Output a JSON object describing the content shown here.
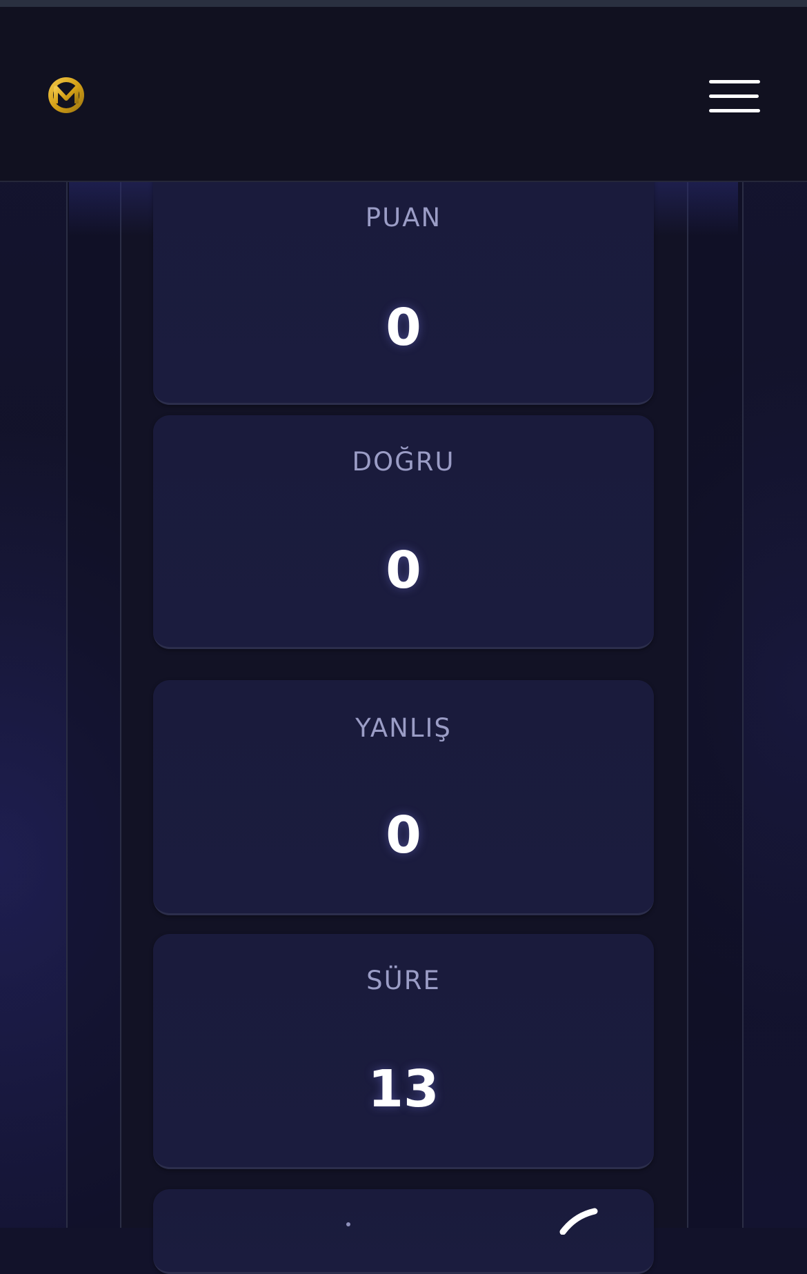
{
  "header": {
    "logo_name": "m-logo",
    "menu_icon": "hamburger-menu-icon"
  },
  "stats": [
    {
      "label": "PUAN",
      "value": "0"
    },
    {
      "label": "DOĞRU",
      "value": "0"
    },
    {
      "label": "YANLIŞ",
      "value": "0"
    },
    {
      "label": "SÜRE",
      "value": "13"
    }
  ],
  "colors": {
    "background": "#12122a",
    "header": "#111120",
    "card": "#1a1b3c",
    "label": "#9b9dc6",
    "value": "#ffffff",
    "logo_gold": "#d4a017"
  }
}
